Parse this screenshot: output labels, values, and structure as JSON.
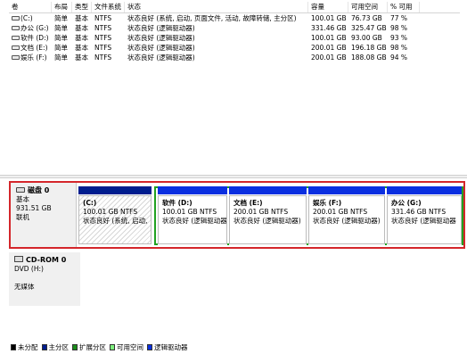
{
  "volume_list": {
    "headers": {
      "volume": "卷",
      "layout": "布局",
      "type": "类型",
      "fs": "文件系统",
      "status": "状态",
      "capacity": "容量",
      "free": "可用空间",
      "pct": "% 可用"
    },
    "rows": [
      {
        "volume": "(C:)",
        "layout": "简单",
        "type": "基本",
        "fs": "NTFS",
        "status": "状态良好 (系统, 启动, 页面文件, 活动, 故障转储, 主分区)",
        "capacity": "100.01 GB",
        "free": "76.73 GB",
        "pct": "77 %"
      },
      {
        "volume": "办公 (G:)",
        "layout": "简单",
        "type": "基本",
        "fs": "NTFS",
        "status": "状态良好 (逻辑驱动器)",
        "capacity": "331.46 GB",
        "free": "325.47 GB",
        "pct": "98 %"
      },
      {
        "volume": "软件 (D:)",
        "layout": "简单",
        "type": "基本",
        "fs": "NTFS",
        "status": "状态良好 (逻辑驱动器)",
        "capacity": "100.01 GB",
        "free": "93.00 GB",
        "pct": "93 %"
      },
      {
        "volume": "文档 (E:)",
        "layout": "简单",
        "type": "基本",
        "fs": "NTFS",
        "status": "状态良好 (逻辑驱动器)",
        "capacity": "200.01 GB",
        "free": "196.18 GB",
        "pct": "98 %"
      },
      {
        "volume": "娱乐 (F:)",
        "layout": "简单",
        "type": "基本",
        "fs": "NTFS",
        "status": "状态良好 (逻辑驱动器)",
        "capacity": "200.01 GB",
        "free": "188.08 GB",
        "pct": "94 %"
      }
    ]
  },
  "disk0": {
    "name": "磁盘 0",
    "type": "基本",
    "size": "931.51 GB",
    "state": "联机",
    "partitions": [
      {
        "title": "(C:)",
        "size": "100.01 GB NTFS",
        "status": "状态良好 (系统, 启动,",
        "kind": "primary"
      },
      {
        "title": "软件  (D:)",
        "size": "100.01 GB NTFS",
        "status": "状态良好 (逻辑驱动器",
        "kind": "logical"
      },
      {
        "title": "文档  (E:)",
        "size": "200.01 GB NTFS",
        "status": "状态良好 (逻辑驱动器)",
        "kind": "logical"
      },
      {
        "title": "娱乐  (F:)",
        "size": "200.01 GB NTFS",
        "status": "状态良好 (逻辑驱动器)",
        "kind": "logical"
      },
      {
        "title": "办公  (G:)",
        "size": "331.46 GB NTFS",
        "status": "状态良好 (逻辑驱动器",
        "kind": "logical"
      }
    ]
  },
  "cdrom0": {
    "name": "CD-ROM 0",
    "drive": "DVD (H:)",
    "media": "无媒体"
  },
  "legend": [
    {
      "label": "未分配",
      "color": "#000000"
    },
    {
      "label": "主分区",
      "color": "#001d8e"
    },
    {
      "label": "扩展分区",
      "color": "#1a8c1a"
    },
    {
      "label": "可用空间",
      "color": "#7df07d"
    },
    {
      "label": "逻辑驱动器",
      "color": "#0a2fe0"
    }
  ]
}
